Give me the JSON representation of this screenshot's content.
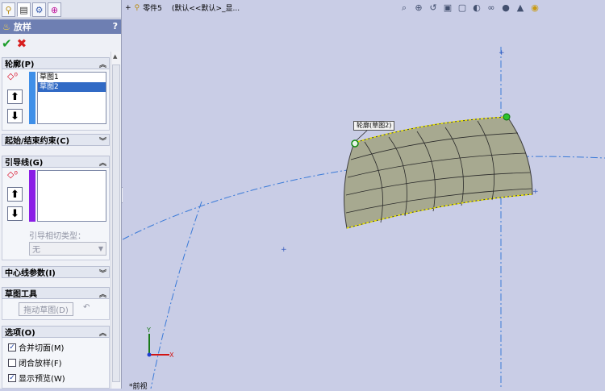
{
  "panel": {
    "title": "放样",
    "help": "?",
    "tabs": [
      "feature-manager-icon",
      "property-manager-icon",
      "configuration-manager-icon",
      "dimxpert-icon"
    ],
    "profiles": {
      "header": "轮廓(P)",
      "items": [
        "草图1",
        "草图2"
      ],
      "selected_index": 1
    },
    "constraints": {
      "header": "起始/结束约束(C)"
    },
    "guides": {
      "header": "引导线(G)",
      "tangent_label": "引导相切类型：",
      "tangent_value": "无"
    },
    "centerline": {
      "header": "中心线参数(I)"
    },
    "sketch_tools": {
      "header": "草图工具",
      "drag_button": "拖动草图(D)"
    },
    "options": {
      "header": "选项(O)",
      "items": [
        {
          "label": "合并切面(M)",
          "checked": true
        },
        {
          "label": "闭合放样(F)",
          "checked": false
        },
        {
          "label": "显示预览(W)",
          "checked": true
        }
      ]
    }
  },
  "viewport": {
    "breadcrumb_part": "零件5",
    "breadcrumb_config": "(默认<<默认>_显...",
    "view_name": "*前视",
    "callout": "轮廓(草图2)",
    "accent_profile": "#3f8fe8",
    "accent_guide": "#8a1ee6"
  }
}
